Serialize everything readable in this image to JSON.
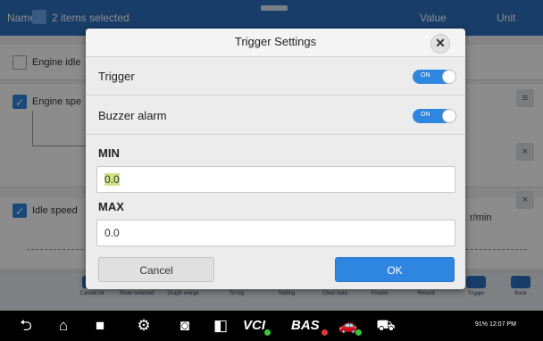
{
  "background": {
    "header": {
      "name": "Name",
      "selected": "2 items selected",
      "value": "Value",
      "unit": "Unit"
    },
    "rows": [
      {
        "label": "Engine idle",
        "checked": false
      },
      {
        "label": "Engine spe",
        "checked": true
      },
      {
        "label": "Idle speed",
        "checked": true,
        "unit": "r/min"
      }
    ],
    "toolbar": [
      "Cancel All",
      "Show selected",
      "Graph merge",
      "To log",
      "Setting",
      "Clear data",
      "Freeze",
      "Record",
      "Trigger",
      "Back"
    ]
  },
  "dialog": {
    "title": "Trigger Settings",
    "trigger": {
      "label": "Trigger",
      "state": "ON"
    },
    "buzzer": {
      "label": "Buzzer alarm",
      "state": "ON"
    },
    "min": {
      "label": "MIN",
      "value": "0.0"
    },
    "max": {
      "label": "MAX",
      "value": "0.0"
    },
    "cancel_label": "Cancel",
    "ok_label": "OK"
  },
  "navbar": {
    "vci_label": "VCI",
    "bas_label": "BAS",
    "status": "91% 12:07 PM"
  },
  "colors": {
    "accent": "#2f86e0",
    "header": "#2f6fbf",
    "green": "#37c837",
    "red": "#e8323c"
  }
}
